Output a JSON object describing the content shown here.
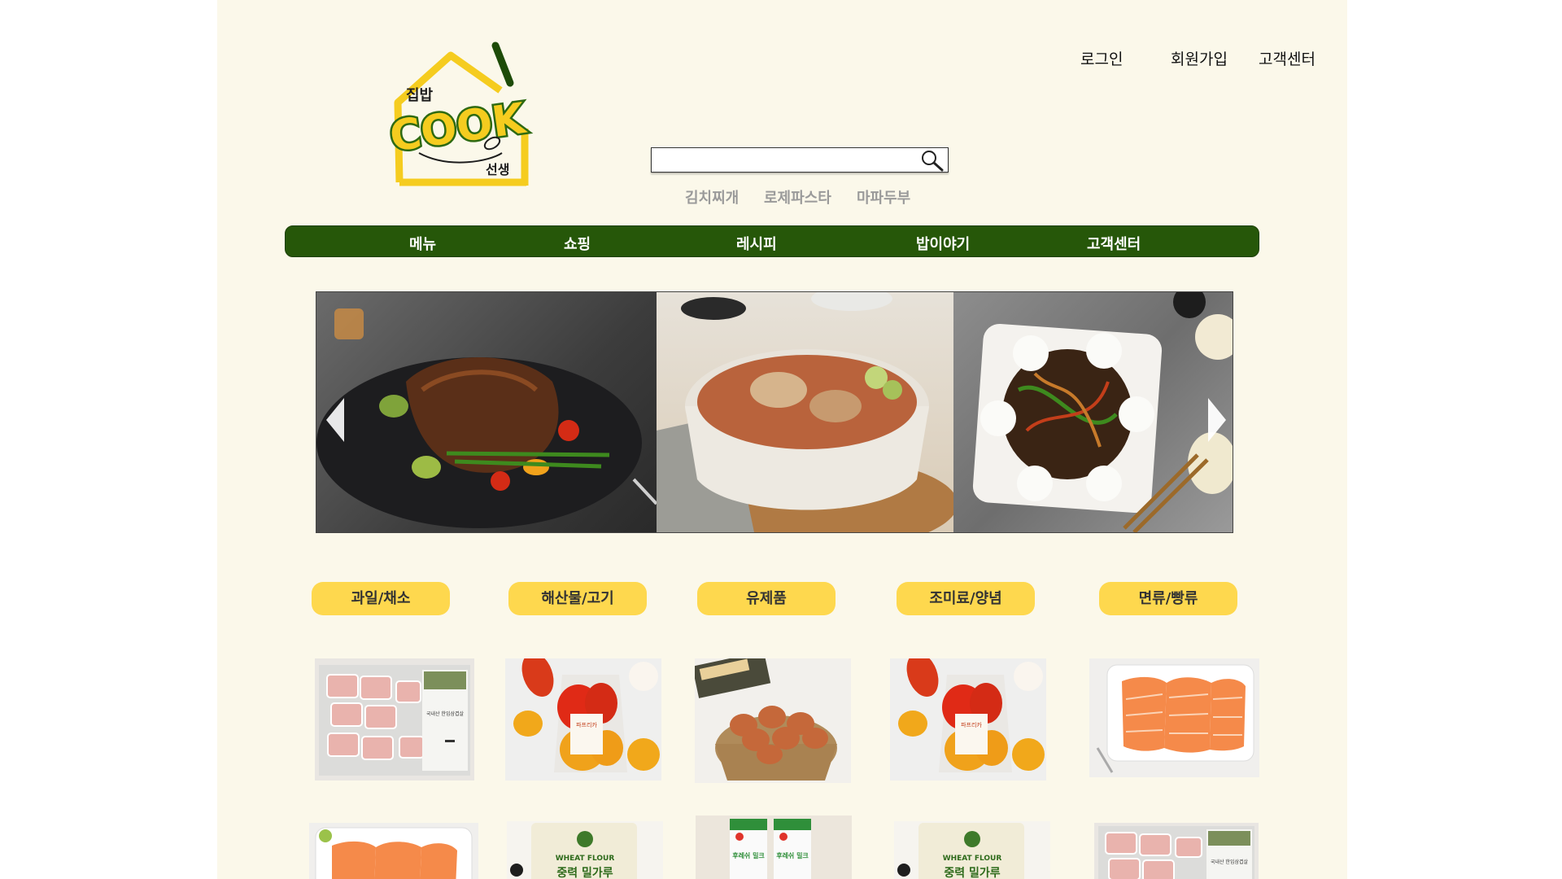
{
  "brand": {
    "logo_top": "집밥",
    "logo_main": "COOK",
    "logo_bottom": "선생",
    "colors": {
      "logo_yellow": "#f5cc1f",
      "logo_green": "#2e6a12",
      "nav_green": "#265709",
      "category_yellow": "#fed84e",
      "page_bg": "#fbf8ea"
    }
  },
  "top_links": {
    "login": "로그인",
    "signup": "회원가입",
    "support": "고객센터"
  },
  "search": {
    "placeholder": "",
    "value": "",
    "icon": "search-icon"
  },
  "keywords": [
    "김치찌개",
    "로제파스타",
    "마파두부"
  ],
  "nav": {
    "items": [
      "메뉴",
      "쇼핑",
      "레시피",
      "밥이야기",
      "고객센터"
    ]
  },
  "slider": {
    "slides": [
      "steak-image",
      "braised-chicken-pot-image",
      "jajang-noodle-image"
    ],
    "prev_icon": "arrow-left-icon",
    "next_icon": "arrow-right-icon"
  },
  "categories": [
    "과일/채소",
    "해산물/고기",
    "유제품",
    "조미료/양념",
    "면류/빵류"
  ],
  "products": {
    "row1": [
      "pork-belly-image",
      "bell-pepper-image",
      "eggs-image",
      "bell-pepper-image",
      "salmon-image"
    ],
    "row2": [
      "salmon-image",
      "wheat-flour-image",
      "milk-image",
      "wheat-flour-image",
      "pork-belly-image"
    ]
  },
  "product_labels": {
    "pork_label": "국내산 한입삼겹살",
    "pepper_label": "파프리카",
    "flour_en": "WHEAT FLOUR",
    "flour_ko": "중력 밀가루",
    "milk_label": "후레쉬 밀크"
  }
}
